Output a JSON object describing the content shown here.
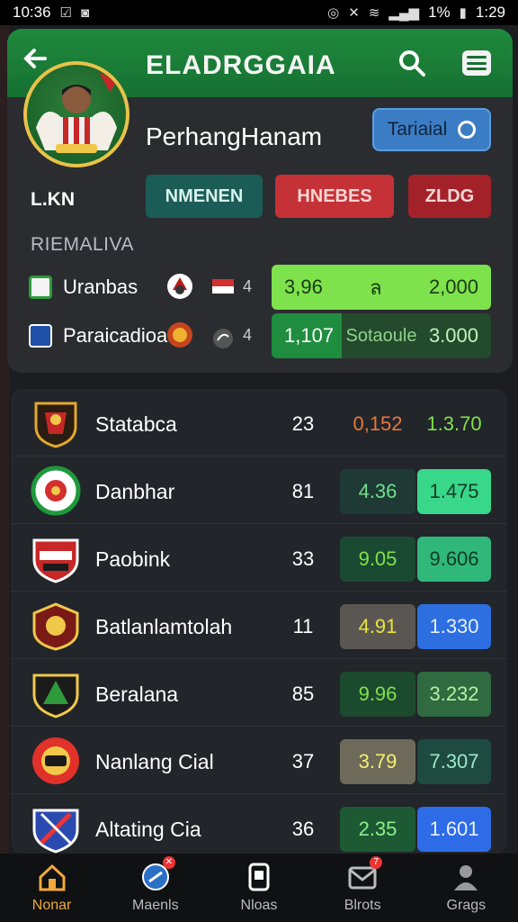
{
  "status_bar": {
    "time_left": "10:36",
    "battery": "1%",
    "time_right": "1:29"
  },
  "header": {
    "title": "ELADRGGAIA",
    "player_name": "PerhangHanam",
    "follow_label": "Tariaial"
  },
  "tabs": {
    "league": "L.KN",
    "items": [
      "NMENEN",
      "HNEBES",
      "ZLDG"
    ]
  },
  "section_label": "RIEMALIVA",
  "mini_rows": [
    {
      "name": "Uranbas",
      "score": "4",
      "odds": [
        "3,96",
        "ล",
        "2,000"
      ]
    },
    {
      "name": "Paraicadioa",
      "score": "4",
      "odds": [
        "1,107",
        "Sotaoule",
        "3.000"
      ]
    }
  ],
  "teams": [
    {
      "name": "Statabca",
      "num": "23",
      "odd_a": "0,152",
      "odd_b": "1.3.70"
    },
    {
      "name": "Danbhar",
      "num": "81",
      "odd_a": "4.36",
      "odd_b": "1.475"
    },
    {
      "name": "Paobink",
      "num": "33",
      "odd_a": "9.05",
      "odd_b": "9.606"
    },
    {
      "name": "Batlanlamtolah",
      "num": "11",
      "odd_a": "4.91",
      "odd_b": "1.330"
    },
    {
      "name": "Beralana",
      "num": "85",
      "odd_a": "9.96",
      "odd_b": "3.232"
    },
    {
      "name": "Nanlang Cial",
      "num": "37",
      "odd_a": "3.79",
      "odd_b": "7.307"
    },
    {
      "name": "Altating Cia",
      "num": "36",
      "odd_a": "2.35",
      "odd_b": "1.601"
    }
  ],
  "bottom_nav": [
    "Nonar",
    "Maenls",
    "Nloas",
    "Blrots",
    "Grags"
  ],
  "colors": {
    "header_green": "#1f8a3c",
    "accent_orange": "#f0a93a",
    "follow_blue": "#3b7dc4"
  },
  "icons": [
    "back-arrow-icon",
    "search-icon",
    "menu-icon",
    "home-icon",
    "ball-icon",
    "phone-icon",
    "mail-icon",
    "user-icon"
  ]
}
